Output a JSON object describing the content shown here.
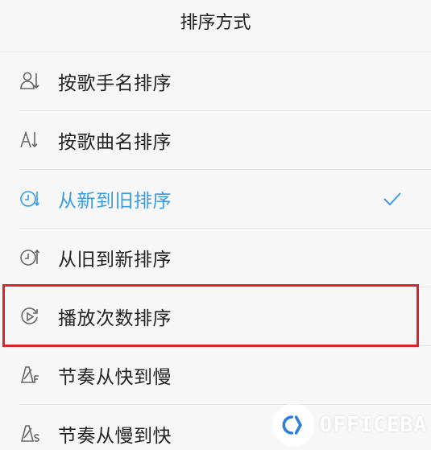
{
  "header": {
    "title": "排序方式"
  },
  "options": [
    {
      "label": "按歌手名排序",
      "icon": "singer-sort-icon"
    },
    {
      "label": "按歌曲名排序",
      "icon": "az-sort-icon"
    },
    {
      "label": "从新到旧排序",
      "icon": "clock-sort-icon",
      "selected": true
    },
    {
      "label": "从旧到新排序",
      "icon": "clock-sort-icon"
    },
    {
      "label": "播放次数排序",
      "icon": "play-count-icon"
    },
    {
      "label": "节奏从快到慢",
      "icon": "metronome-fast-icon"
    },
    {
      "label": "节奏从慢到快",
      "icon": "metronome-slow-icon"
    }
  ],
  "watermark": {
    "text": "OFFICEBA"
  },
  "colors": {
    "accent": "#3a9be0",
    "highlight": "#d9252a",
    "background": "#f7f7f7"
  }
}
